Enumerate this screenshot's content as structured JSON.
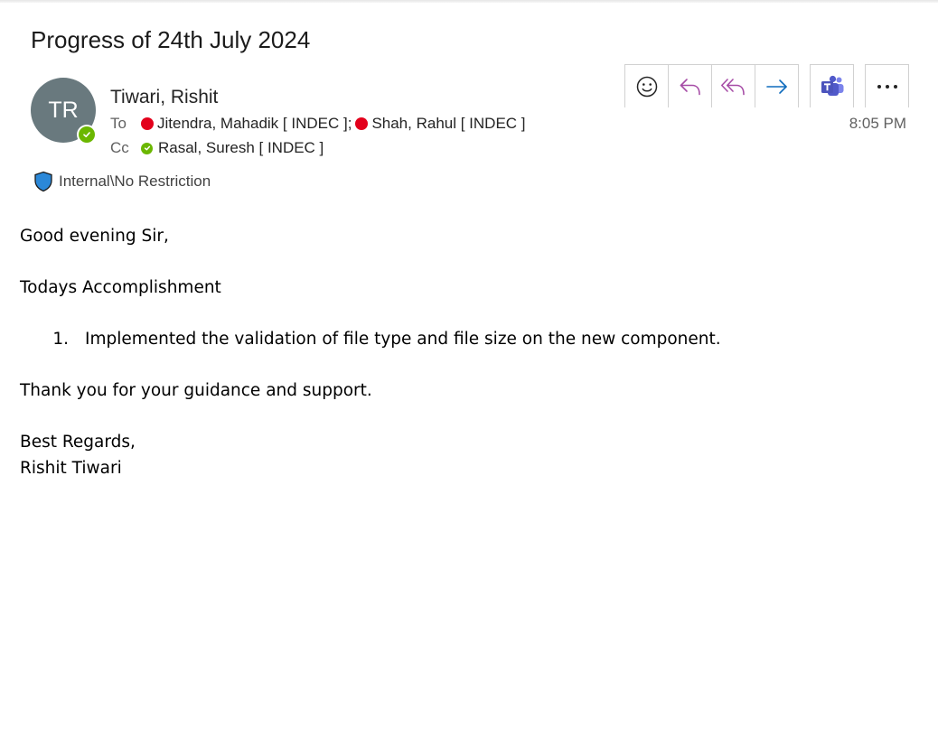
{
  "email": {
    "subject": "Progress of 24th July 2024",
    "sender": {
      "initials": "TR",
      "name": "Tiwari, Rishit",
      "presence_color": "#6bb700"
    },
    "to_label": "To",
    "cc_label": "Cc",
    "to": [
      {
        "name": "Jitendra, Mahadik [ INDEC ]",
        "status": "busy",
        "status_color": "#e3001b"
      },
      {
        "name": "Shah, Rahul [ INDEC ]",
        "status": "busy",
        "status_color": "#e3001b"
      }
    ],
    "recipient_separator": ";",
    "cc": [
      {
        "name": "Rasal, Suresh [ INDEC ]",
        "status": "available",
        "status_color": "#6bb700"
      }
    ],
    "time": "8:05 PM",
    "sensitivity_label": "Internal\\No Restriction",
    "toolbar": [
      {
        "icon": "emoji-smile-icon"
      },
      {
        "icon": "reply-icon"
      },
      {
        "icon": "reply-all-icon"
      },
      {
        "icon": "forward-icon"
      },
      {
        "icon": "teams-icon"
      },
      {
        "icon": "more-options-icon"
      }
    ],
    "accent_color": "#a64ca6",
    "forward_color": "#0f6cbd",
    "body": {
      "greeting": "Good evening Sir,",
      "heading": "Todays Accomplishment",
      "items": [
        {
          "number": "1.",
          "text": "Implemented the validation of file type and file size on the new component."
        }
      ],
      "thanks": "Thank you for your guidance and support.",
      "closing": "Best Regards,",
      "signature": "Rishit Tiwari"
    }
  }
}
